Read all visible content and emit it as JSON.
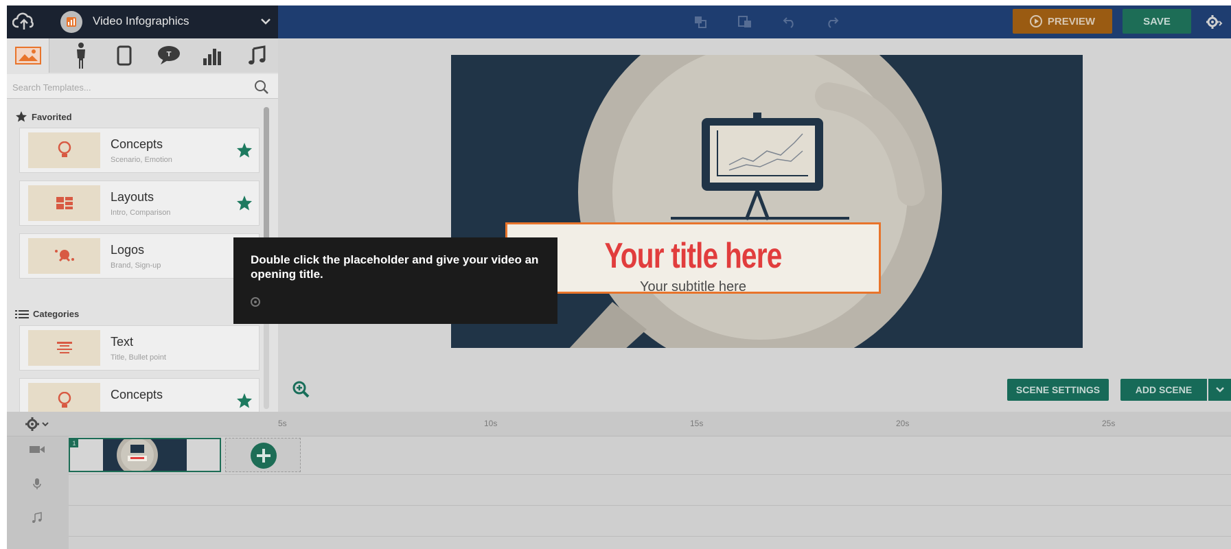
{
  "colors": {
    "topbar": "#1e3d70",
    "accent_orange": "#e8742b",
    "accent_green": "#1d6d56",
    "title_red": "#e13d3d",
    "tooltip_bg": "#1b1b1b"
  },
  "header": {
    "project_title": "Video Infographics",
    "preview_label": "PREVIEW",
    "save_label": "SAVE",
    "icons": [
      "cloud-upload-icon",
      "chevron-down-icon",
      "copy-icon",
      "paste-icon",
      "undo-icon",
      "redo-icon",
      "gear-icon"
    ]
  },
  "library": {
    "tabs": [
      "image-icon",
      "character-icon",
      "device-icon",
      "speech-bubble-icon",
      "chart-icon",
      "music-icon"
    ],
    "search_placeholder": "Search Templates...",
    "favorited_label": "Favorited",
    "favorites": [
      {
        "title": "Concepts",
        "subtitle": "Scenario, Emotion"
      },
      {
        "title": "Layouts",
        "subtitle": "Intro, Comparison"
      },
      {
        "title": "Logos",
        "subtitle": "Brand, Sign-up"
      }
    ],
    "categories_label": "Categories",
    "categories": [
      {
        "title": "Text",
        "subtitle": "Title, Bullet point"
      },
      {
        "title": "Concepts",
        "subtitle": ""
      }
    ]
  },
  "stage": {
    "title": "Your title here",
    "subtitle": "Your subtitle here"
  },
  "tooltip": {
    "text": "Double click the placeholder and give your video an opening title."
  },
  "scene_controls": {
    "scene_settings_label": "SCENE SETTINGS",
    "add_scene_label": "ADD SCENE"
  },
  "timeline": {
    "ticks": [
      "5s",
      "10s",
      "15s",
      "20s",
      "25s"
    ],
    "scene_number": "1"
  }
}
